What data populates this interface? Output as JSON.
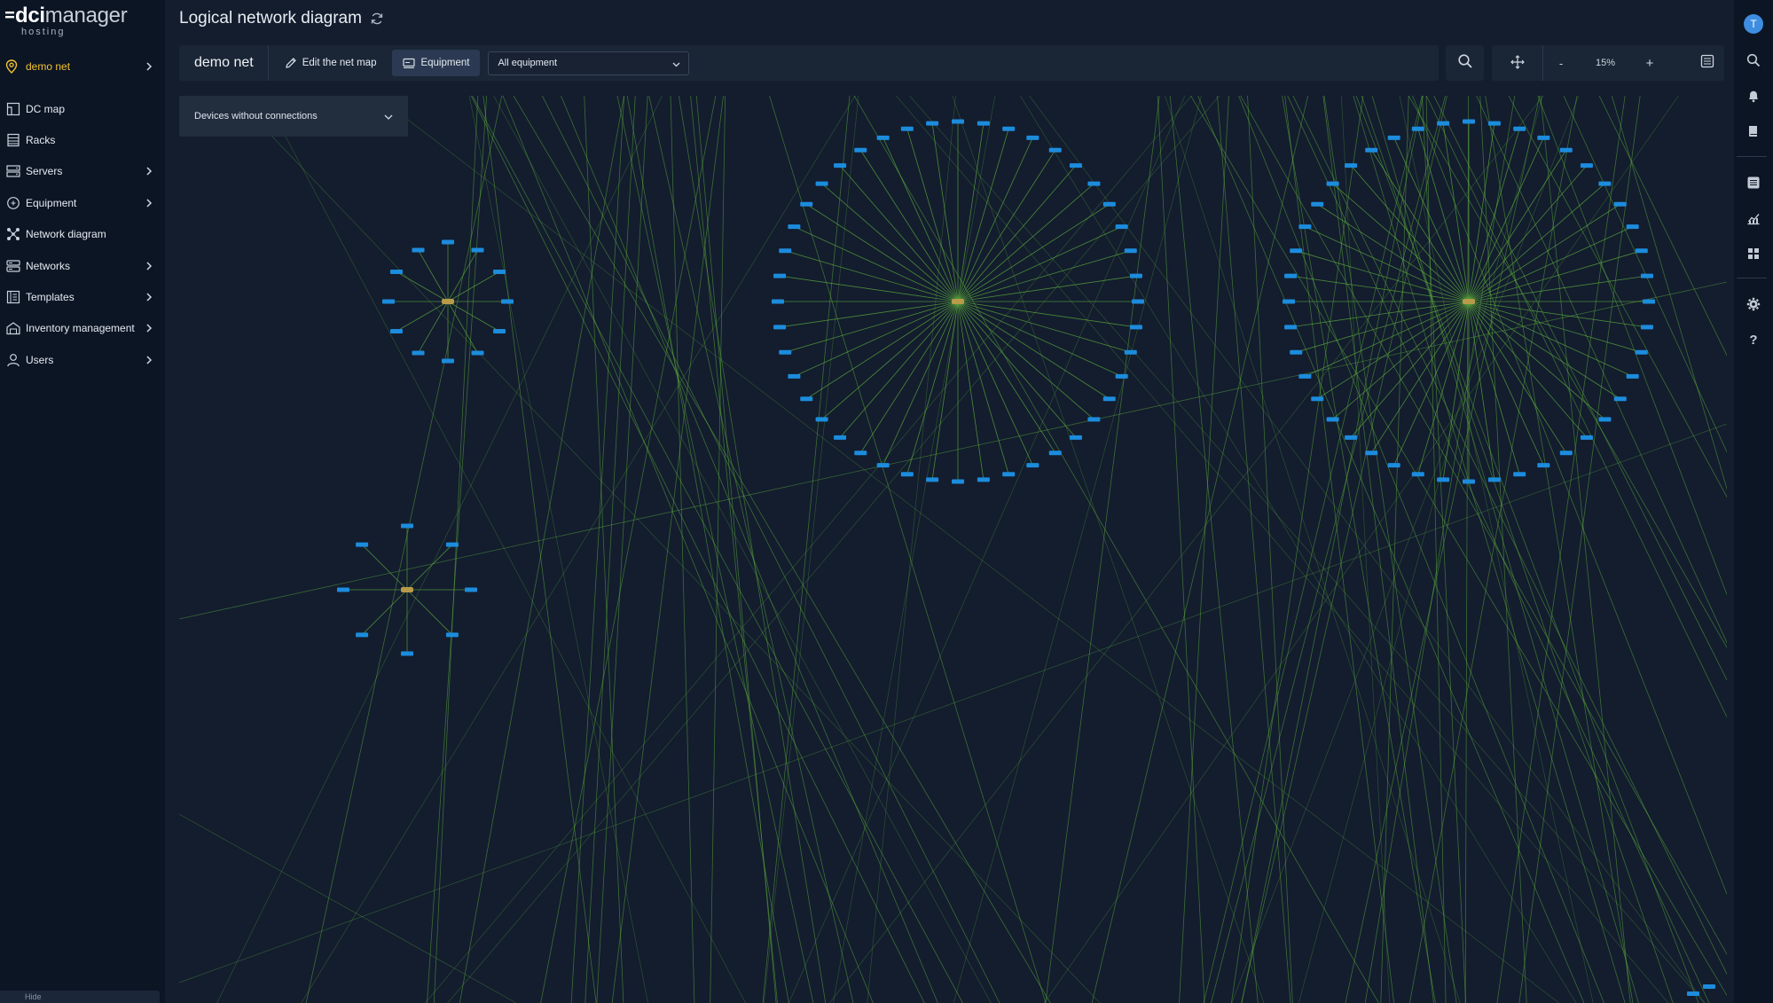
{
  "app": {
    "logo_bold": "dci",
    "logo_light": "manager",
    "logo_sub": "hosting"
  },
  "sidebar": {
    "project": "demo net",
    "items": [
      {
        "label": "DC map",
        "icon": "map-icon",
        "chevron": false
      },
      {
        "label": "Racks",
        "icon": "rack-icon",
        "chevron": false
      },
      {
        "label": "Servers",
        "icon": "server-icon",
        "chevron": true
      },
      {
        "label": "Equipment",
        "icon": "equipment-icon",
        "chevron": true
      },
      {
        "label": "Network diagram",
        "icon": "network-diagram-icon",
        "chevron": false
      },
      {
        "label": "Networks",
        "icon": "networks-icon",
        "chevron": true
      },
      {
        "label": "Templates",
        "icon": "templates-icon",
        "chevron": true
      },
      {
        "label": "Inventory management",
        "icon": "inventory-icon",
        "chevron": true
      },
      {
        "label": "Users",
        "icon": "user-icon",
        "chevron": true
      }
    ],
    "bottom_label": "Hide"
  },
  "header": {
    "title": "Logical network diagram"
  },
  "toolbar": {
    "net_name": "demo net",
    "edit_label": "Edit the net map",
    "equipment_label": "Equipment",
    "filter_value": "All equipment"
  },
  "zoom": {
    "minus": "-",
    "level": "15%",
    "plus": "+"
  },
  "panel": {
    "devices_without_connections": "Devices without connections"
  },
  "user": {
    "avatar_letter": "T"
  },
  "colors": {
    "background": "#131d2e",
    "sidebar": "#0c1524",
    "accent_yellow": "#f1c232",
    "node_blue": "#1c8cdd",
    "link_green": "#5fae3c",
    "hub_orange": "#b79a4a"
  }
}
